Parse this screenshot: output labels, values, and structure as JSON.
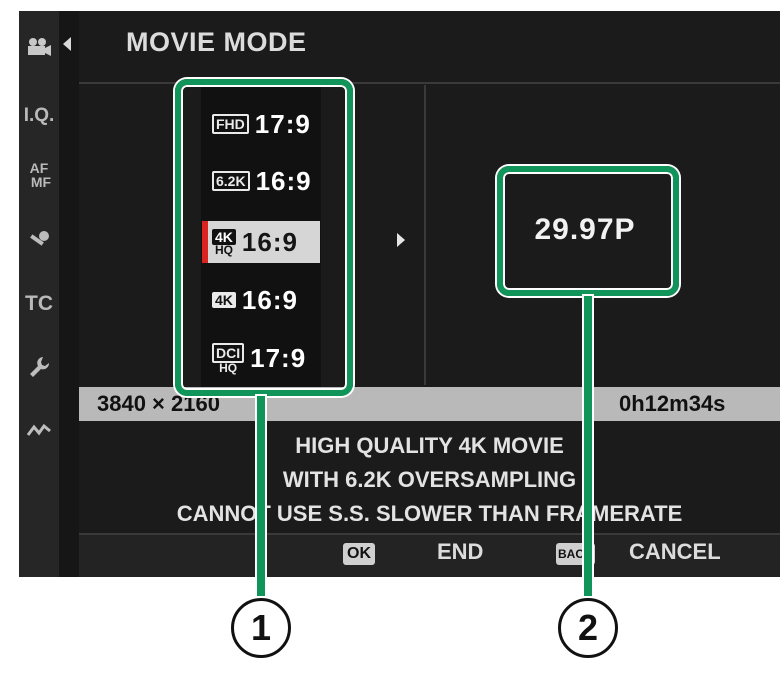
{
  "header": {
    "title": "MOVIE MODE"
  },
  "sidebar": {
    "items": [
      {
        "icon": "movie-camera-icon",
        "label": ""
      },
      {
        "icon": "image-quality-icon",
        "label": "I.Q."
      },
      {
        "icon": "af-mf-icon",
        "label": "AF MF"
      },
      {
        "icon": "microphone-icon",
        "label": ""
      },
      {
        "icon": "timecode-icon",
        "label": "TC"
      },
      {
        "icon": "wrench-icon",
        "label": ""
      },
      {
        "icon": "connection-icon",
        "label": ""
      }
    ]
  },
  "movie_modes": [
    {
      "badge": "FHD",
      "sub": "",
      "ratio": "17:9",
      "selected": false
    },
    {
      "badge": "6.2K",
      "sub": "",
      "ratio": "16:9",
      "selected": false
    },
    {
      "badge": "4K",
      "sub": "HQ",
      "ratio": "16:9",
      "selected": true
    },
    {
      "badge": "4K",
      "sub": "",
      "ratio": "16:9",
      "selected": false
    },
    {
      "badge": "DCI",
      "sub": "HQ",
      "ratio": "17:9",
      "selected": false
    }
  ],
  "framerate": "29.97P",
  "info_bar": {
    "resolution": "3840 × 2160",
    "recording_time": "0h12m34s"
  },
  "description": [
    "HIGH QUALITY 4K MOVIE",
    "WITH 6.2K OVERSAMPLING",
    "CANNOT USE S.S. SLOWER THAN FRAMERATE"
  ],
  "footer": {
    "ok_key": "OK",
    "ok_label": "END",
    "back_key": "BACK",
    "back_label": "CANCEL"
  },
  "callouts": [
    "1",
    "2"
  ],
  "colors": {
    "accent_green": "#11945a",
    "selection_red": "#d9231f"
  }
}
